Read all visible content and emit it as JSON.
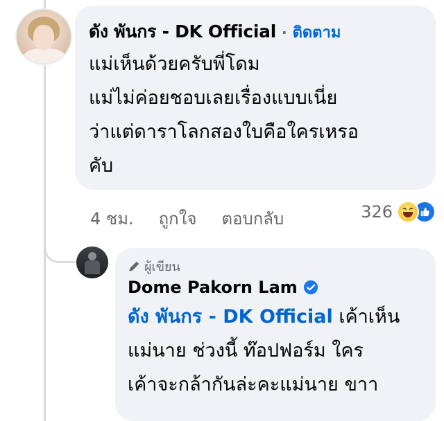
{
  "comment": {
    "author": "ดัง พันกร - DK Official",
    "separator": "·",
    "follow_label": "ติดตาม",
    "lines": [
      "แม่เห็นด้วยครับพี่โดม",
      "แม่ไม่ค่อยชอบเลยเรื่องแบบเนี่ย",
      "ว่าแต่ดาราโลกสองใบคือใครเหรอ",
      "คับ"
    ],
    "time": "4 ชม.",
    "like_label": "ถูกใจ",
    "reply_label": "ตอบกลับ",
    "reaction_count": "326",
    "reaction_icons": [
      "haha-icon",
      "like-icon"
    ]
  },
  "reply": {
    "badge_label": "ผู้เขียน",
    "author": "Dome Pakorn Lam",
    "mention": "ดัง พันกร - DK Official",
    "text_after_mention": " เค้าเห็น",
    "lines": [
      "แม่นาย ช่วงนี้ ท๊อปฟอร์ม ใคร",
      "เค้าจะกล้ากันล่ะคะแม่นาย ขาา"
    ]
  },
  "colors": {
    "bubble": "#f0f2f5",
    "link": "#0064d1",
    "secondary_text": "#65676b",
    "thread_line": "#d8dadf"
  }
}
